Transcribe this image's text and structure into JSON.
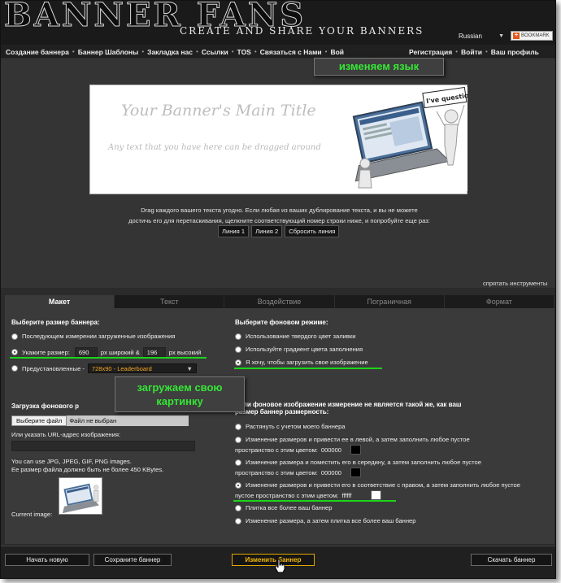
{
  "header": {
    "logo": "BANNER FANS",
    "tagline": "CREATE AND SHARE YOUR BANNERS",
    "language": "Russian",
    "bookmark_label": "BOOKMARK"
  },
  "nav": {
    "items": [
      "Создание баннера",
      "Баннер Шаблоны",
      "Закладка нас",
      "Ссылки",
      "TOS",
      "Связаться с Нами",
      "Вой",
      "Регистрация",
      "Войти",
      "Ваш профиль"
    ]
  },
  "callouts": {
    "language": "изменяем язык",
    "upload": "загружаем свою картинку"
  },
  "preview": {
    "title": "Your Banner's Main Title",
    "subtitle": "Any text that you have here can be dragged around",
    "art_caption": "I've question!"
  },
  "drag_help": {
    "line1": "Drag каждого вашего текста угодно. Если любая из ваших дублирование текста, и вы не можете",
    "line2": "достичь его для перетаскивания, щелкните соответствующий номер строки ниже, и попробуйте еще раз:"
  },
  "line_buttons": [
    "Линия 1",
    "Линия 2",
    "Сбросить линия"
  ],
  "hide_tools": "спрятать инструменты",
  "tabs": [
    "Макет",
    "Текст",
    "Воздействие",
    "Пограничная",
    "Формат"
  ],
  "size": {
    "title": "Выберите размер баннера:",
    "option_uploaded": "Последующем измерении загруженные изображения",
    "option_custom": "Укажите размер:",
    "width": "690",
    "width_suffix": "px широкий &",
    "height": "196",
    "height_suffix": "px высокий",
    "option_preset": "Предустановленные -",
    "preset_value": "728x90 - Leaderboard"
  },
  "background_mode": {
    "title": "Выберите фоновом режиме:",
    "options": [
      "Использование твердого цвет заливки",
      "Используйте градиент цвета заполнения",
      "Я хочу, чтобы загрузить свое изображение"
    ]
  },
  "upload": {
    "title": "Загрузка фонового р",
    "file_button": "Выберите файл",
    "file_name": "Файл не выбран",
    "url_label": "Или указать URL-адрес изображения:",
    "formats": "You can use JPG, JPEG, GIF, PNG images.",
    "size_limit": "Ее размер файла должно быть не более 450 KBytes.",
    "current_label": "Current image:"
  },
  "resize": {
    "title_l1": "Если фоновое изображение измерение не является такой же, как ваш",
    "title_l2": "размер баннер размерность:",
    "stretch": "Растянуть с учетом моего баннера",
    "resize_left_l1": "Изменение размеров и привести ее в левой, а затем заполнить любое пустое",
    "resize_left_l2": "пространство с этим цветом:",
    "color1": "000000",
    "resize_center_l1": "Изменение размера и поместить его в середину, а затем заполнить любое пустое",
    "resize_center_l2": "пространство с этим цветом:",
    "color2": "000000",
    "resize_right_l1": "Изменение размеров и привести его в соответствие с правом, а затем заполнить любое пустое",
    "resize_right_l2": "пустое пространство с этим цветом:",
    "color3": "ffffff",
    "tile": "Плитка все более ваш баннер",
    "resize_tile": "Изменение размера, а затем плитка все более ваш баннер"
  },
  "footer": {
    "new": "Начать новую",
    "save": "Сохраните баннер",
    "change": "Изменить баннер",
    "download": "Скачать баннер"
  },
  "colors": {
    "accent_green": "#1bd41b",
    "button_orange": "#f5b800",
    "background": "#2b2b2b"
  }
}
